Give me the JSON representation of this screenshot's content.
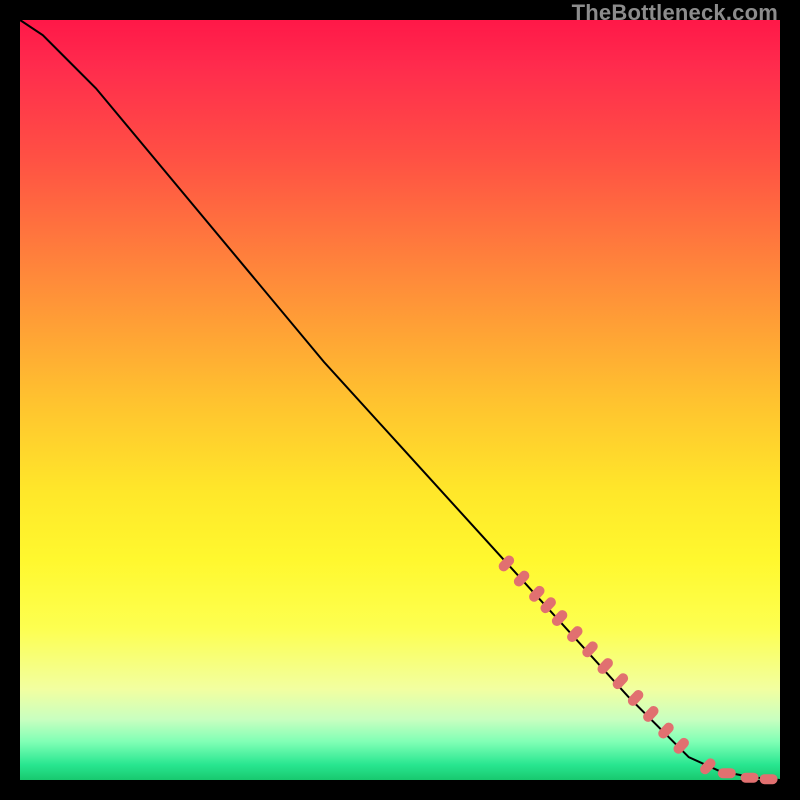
{
  "watermark": "TheBottleneck.com",
  "colors": {
    "marker": "#e17070",
    "line": "#000000",
    "gradient_top": "#ff1848",
    "gradient_bottom": "#18c86e"
  },
  "chart_data": {
    "type": "line",
    "title": "",
    "xlabel": "",
    "ylabel": "",
    "ylim": [
      0,
      100
    ],
    "xlim": [
      0,
      100
    ],
    "line": {
      "x": [
        0,
        3,
        6,
        10,
        15,
        20,
        30,
        40,
        50,
        60,
        70,
        80,
        88,
        92,
        95,
        97,
        99,
        100
      ],
      "y": [
        100,
        98,
        95,
        91,
        85,
        79,
        67,
        55,
        44,
        33,
        22,
        11,
        3,
        1.2,
        0.6,
        0.3,
        0.1,
        0
      ]
    },
    "series": [
      {
        "name": "segment-markers",
        "style": "thick-dot",
        "x": [
          64,
          66,
          68,
          69.5,
          71,
          73,
          75,
          77,
          79,
          81,
          83,
          85,
          87,
          90.5,
          93,
          96,
          98.5
        ],
        "y": [
          28.5,
          26.5,
          24.5,
          23,
          21.3,
          19.2,
          17.2,
          15,
          13,
          10.8,
          8.7,
          6.5,
          4.5,
          1.8,
          0.9,
          0.3,
          0.1
        ]
      }
    ]
  }
}
